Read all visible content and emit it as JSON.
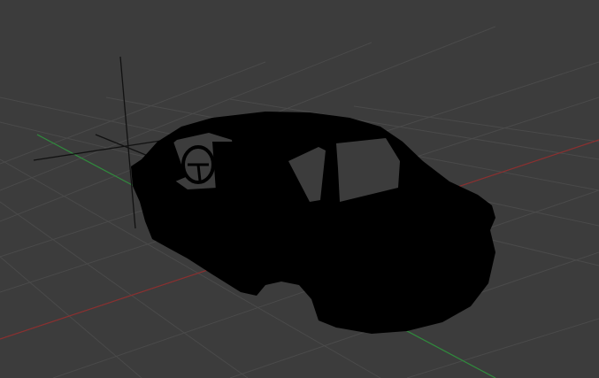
{
  "viewport": {
    "background": "#3c3c3c",
    "grid_color": "#4a4a4a",
    "x_axis_color": "#8b2f2f",
    "z_axis_color": "#2f8b3c",
    "gizmo_color": "#111111",
    "model_color": "#000000",
    "model": "car-body-silhouette",
    "gizmo": "origin-axes-gizmo"
  }
}
